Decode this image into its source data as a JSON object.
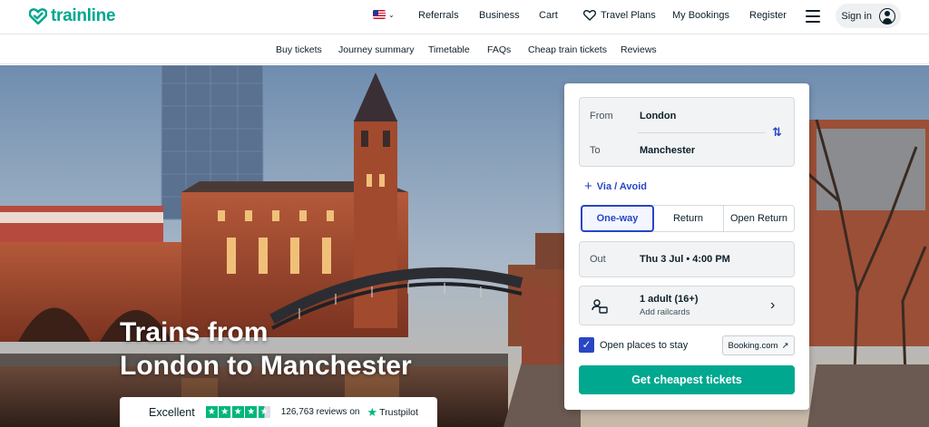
{
  "brand": {
    "name": "trainline",
    "color": "#00a88f"
  },
  "header": {
    "locale": "US",
    "nav": {
      "referrals": "Referrals",
      "business": "Business",
      "cart": "Cart",
      "travel_plans": "Travel Plans",
      "my_bookings": "My Bookings",
      "register": "Register"
    },
    "sign_in": "Sign in"
  },
  "subnav": {
    "items": [
      "Buy tickets",
      "Journey summary",
      "Timetable",
      "FAQs",
      "Cheap train tickets",
      "Reviews"
    ]
  },
  "hero": {
    "title_line1": "Trains from",
    "title_line2": "London to Manchester"
  },
  "trustpilot": {
    "rating_label": "Excellent",
    "reviews": "126,763 reviews on",
    "brand": "Trustpilot",
    "stars": 4.5
  },
  "search": {
    "from_label": "From",
    "from_value": "London",
    "to_label": "To",
    "to_value": "Manchester",
    "via_label": "Via / Avoid",
    "trip_types": [
      "One-way",
      "Return",
      "Open Return"
    ],
    "selected_trip": "One-way",
    "out_label": "Out",
    "out_value": "Thu 3 Jul • 4:00 PM",
    "passengers": "1 adult (16+)",
    "railcards": "Add railcards",
    "open_places_label": "Open places to stay",
    "open_places_checked": true,
    "booking_partner": "Booking.com",
    "cta": "Get cheapest tickets"
  },
  "colors": {
    "accent": "#00a88f",
    "link": "#2846c4",
    "trustpilot": "#00b67a"
  }
}
